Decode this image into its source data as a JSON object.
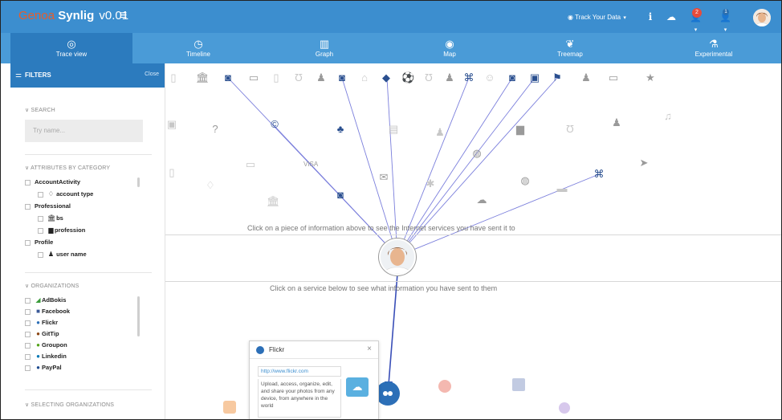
{
  "brand": {
    "logo": "Genoa",
    "name": "Synlig",
    "version": "v0.01"
  },
  "topbar": {
    "track_label": "Track Your Data",
    "notification_count": "2",
    "user_count": "1"
  },
  "tabs": [
    {
      "label": "Trace view",
      "icon": "target-icon",
      "glyph": "◎"
    },
    {
      "label": "Timeline",
      "icon": "clock-icon",
      "glyph": "◷"
    },
    {
      "label": "Graph",
      "icon": "bar-chart-icon",
      "glyph": "▥"
    },
    {
      "label": "Map",
      "icon": "globe-icon",
      "glyph": "◉"
    },
    {
      "label": "Treemap",
      "icon": "leaf-icon",
      "glyph": "❦"
    },
    {
      "label": "Experimental",
      "icon": "flask-icon",
      "glyph": "⚗"
    }
  ],
  "sidebar": {
    "title": "FILTERS",
    "close_label": "Close",
    "search": {
      "title": "SEARCH",
      "placeholder": "Try name..."
    },
    "attributes": {
      "title": "ATTRIBUTES BY CATEGORY",
      "items": [
        {
          "label": "AccountActivity"
        },
        {
          "label": "account type"
        },
        {
          "label": "Professional"
        },
        {
          "label": "bs"
        },
        {
          "label": "profession"
        },
        {
          "label": "Profile"
        },
        {
          "label": "user name"
        }
      ]
    },
    "organizations": {
      "title": "ORGANIZATIONS",
      "items": [
        {
          "label": "AdBokis",
          "color": "#3a9b3a"
        },
        {
          "label": "Facebook",
          "color": "#3b5998"
        },
        {
          "label": "Flickr",
          "color": "#2c6fb7"
        },
        {
          "label": "GitTip",
          "color": "#8b4513"
        },
        {
          "label": "Groupon",
          "color": "#53a318"
        },
        {
          "label": "Linkedin",
          "color": "#0077b5"
        },
        {
          "label": "PayPal",
          "color": "#1e4b8f"
        }
      ]
    },
    "selecting": {
      "title": "SELECTING ORGANIZATIONS"
    }
  },
  "graph": {
    "hint_top": "Click on a piece of information above to see the Internet services you have sent it to",
    "hint_bottom": "Click on a service below to see what information you have sent to them"
  },
  "popup": {
    "title": "Flickr",
    "url": "http://www.flickr.com",
    "description": "Upload, access, organize, edit, and share your photos from any device, from anywhere in the world"
  },
  "colors": {
    "topbar": "#3c8ecf",
    "navbar": "#4a9bd7",
    "active": "#2c7bbe",
    "accent_line": "#6b73d9"
  }
}
